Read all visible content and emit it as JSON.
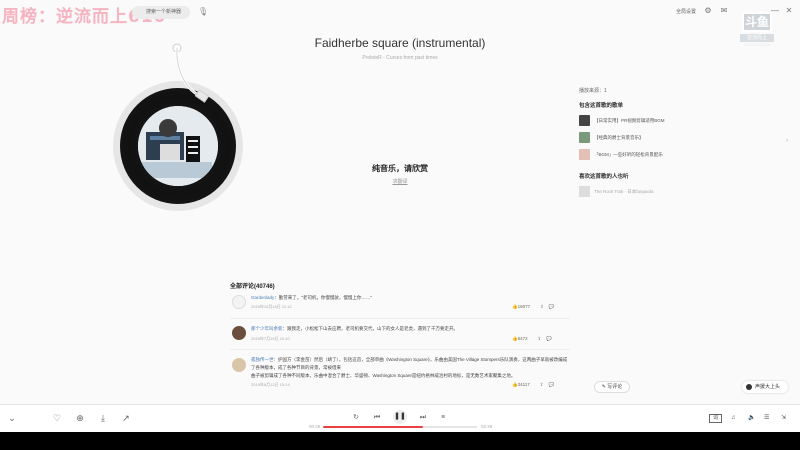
{
  "overlay": {
    "title": "周榜：逆流而上610"
  },
  "topbar": {
    "search_placeholder": "搜索一个新神器",
    "right_text": "全局设置",
    "icons": [
      "mail-icon",
      "gear-icon",
      "skin-icon",
      "mini-mode-icon",
      "minimize-icon",
      "maximize-icon",
      "close-icon"
    ]
  },
  "watermark": {
    "main": "斗鱼",
    "sub": "逆流而上",
    "sub2": "DOUYU.COM"
  },
  "song": {
    "title": "Faidherbe square (instrumental)",
    "subtitle": "ProleteR - Curses from past times"
  },
  "lyrics": {
    "message": "纯音乐，请欣赏",
    "link": "求翻译"
  },
  "right_panel": {
    "source": "播放来源：1",
    "playlists_heading": "包含这首歌的歌单",
    "playlists": [
      {
        "name": "【日常实用】PR视频剪辑适用BGM",
        "color": "#444"
      },
      {
        "name": "【经典的爵士背景音乐】",
        "color": "#7a9a7a"
      },
      {
        "name": "「BGM」一些好听的轻松背景配乐",
        "color": "#e4c0b4"
      }
    ],
    "likers_heading": "喜欢这首歌的人也听",
    "liker": "The Rock Trak · 日本fanpaola"
  },
  "comments": {
    "title": "全部评论(40746)",
    "items": [
      {
        "user": "Gardenlady",
        "text": "勤劳来了，\"老司机，你慢慢驶，慢慢上你……\"",
        "time": "2019年10月15日 11:12",
        "likes": "16077",
        "avatar_color": "#f3f3f3"
      },
      {
        "user": "那个少年叫余新",
        "text": "跟我走，小松松下山去应聘，老司机要交代，山下的女人是老虎，遇到了千万要走开。",
        "time": "2019年7月15日 20:40",
        "likes": "6472",
        "avatar_color": "#6b4e3d"
      },
      {
        "user": "孤独传一世",
        "text": "护国方（李金苗）然后（靖了），包括这首，全部单曲《Washington Square》，乐曲由美国The Village Stompers乐队演奏，这两曲子早就被改编成了各种版本，成了各种节目的背景，常被借来",
        "text2": "曲子被剪辑成了各种不同版本，乐曲中混合了爵士、华盛顿、Washington Square是纽约格林威治村的地标，是无数艺术家聚集之地。",
        "time": "2019年8月12日 15:14",
        "likes": "34117",
        "avatar_color": "#d9c6a8"
      }
    ]
  },
  "buttons": {
    "write_comment": "写评论",
    "voice": "声援大上头"
  },
  "player": {
    "time_current": "00:26",
    "time_total": "02:29",
    "progress": 0.65,
    "lyric_label": "词",
    "list_count": "260"
  }
}
